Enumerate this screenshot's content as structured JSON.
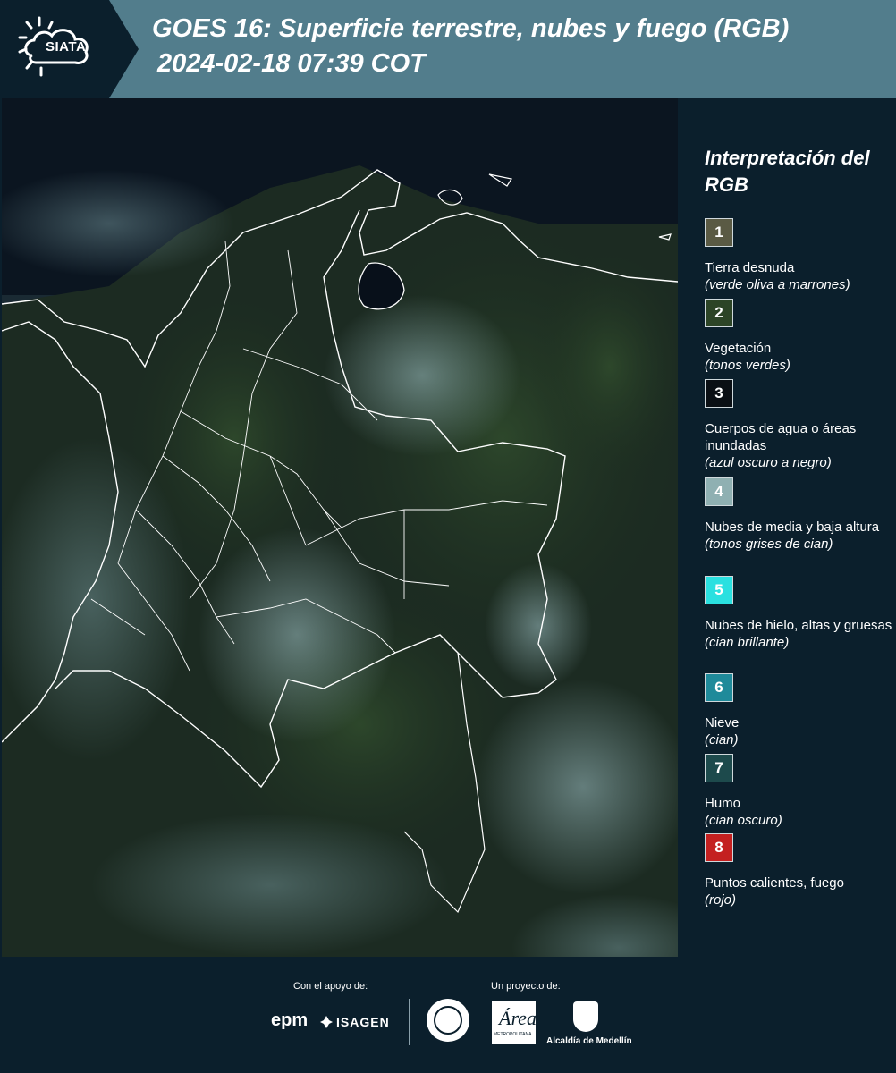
{
  "header": {
    "logo_text": "SIATA",
    "title": "GOES 16: Superficie terrestre, nubes y fuego (RGB)",
    "subtitle": "2024-02-18 07:39 COT"
  },
  "legend": {
    "title": "Interpretación del RGB",
    "items": [
      {
        "number": "1",
        "label": "Tierra desnuda",
        "sub": "(verde oliva a marrones)",
        "color": "#5a5a44"
      },
      {
        "number": "2",
        "label": "Vegetación",
        "sub": "(tonos verdes)",
        "color": "#2c4426"
      },
      {
        "number": "3",
        "label": "Cuerpos de agua o áreas inundadas",
        "sub": "(azul oscuro a negro)",
        "color": "#0a0f14"
      },
      {
        "number": "4",
        "label": "Nubes de media y baja altura",
        "sub": "(tonos grises de cian)",
        "color": "#8fb0b2"
      },
      {
        "number": "5",
        "label": "Nubes de hielo, altas y gruesas",
        "sub": "(cian brillante)",
        "color": "#2ae0e0"
      },
      {
        "number": "6",
        "label": "Nieve",
        "sub": "(cian)",
        "color": "#1f8a9a"
      },
      {
        "number": "7",
        "label": "Humo",
        "sub": "(cian oscuro)",
        "color": "#1d4a4c"
      },
      {
        "number": "8",
        "label": "Puntos calientes, fuego",
        "sub": "(rojo)",
        "color": "#c42020"
      }
    ]
  },
  "footer": {
    "support_label": "Con el apoyo de:",
    "project_label": "Un proyecto de:",
    "sponsors": [
      "epm",
      "ISAGEN"
    ],
    "partners": [
      "Área Metropolitana Valle de Aburrá",
      "Alcaldía de Medellín"
    ],
    "alcaldia_label": "Alcaldía de Medellín",
    "amva_mark": "Área",
    "amva_sub": "METROPOLITANA"
  },
  "colors": {
    "header_bg": "#527d8c",
    "logo_bg": "#0b1f2c",
    "page_bg": "#0b1f2c"
  }
}
